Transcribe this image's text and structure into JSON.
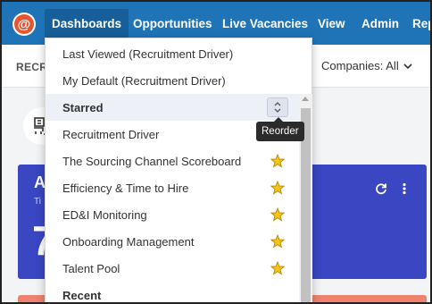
{
  "nav": {
    "items": [
      {
        "label": "Dashboards",
        "active": true
      },
      {
        "label": "Opportunities"
      },
      {
        "label": "Live Vacancies"
      },
      {
        "label": "View"
      },
      {
        "label": "Admin"
      },
      {
        "label": "Rep"
      }
    ]
  },
  "subbar": {
    "left_text": "RECR",
    "companies_label": "Companies: All"
  },
  "dropdown": {
    "top_items": [
      "Last Viewed (Recruitment Driver)",
      "My Default (Recruitment Driver)"
    ],
    "starred_header": "Starred",
    "reorder_tooltip": "Reorder",
    "starred_items": [
      {
        "label": "Recruitment Driver",
        "starred": false
      },
      {
        "label": "The Sourcing Channel Scoreboard",
        "starred": true
      },
      {
        "label": "Efficiency & Time to Hire",
        "starred": true
      },
      {
        "label": "ED&I Monitoring",
        "starred": true
      },
      {
        "label": "Onboarding Management",
        "starred": true
      },
      {
        "label": "Talent Pool",
        "starred": true
      }
    ],
    "recent_header": "Recent"
  },
  "background": {
    "card_letter": "A",
    "card_sub": "Ti",
    "card_value": "7"
  },
  "colors": {
    "nav_bg": "#1f73b7",
    "star": "#f5c518",
    "card_bg": "#3a46c2"
  }
}
